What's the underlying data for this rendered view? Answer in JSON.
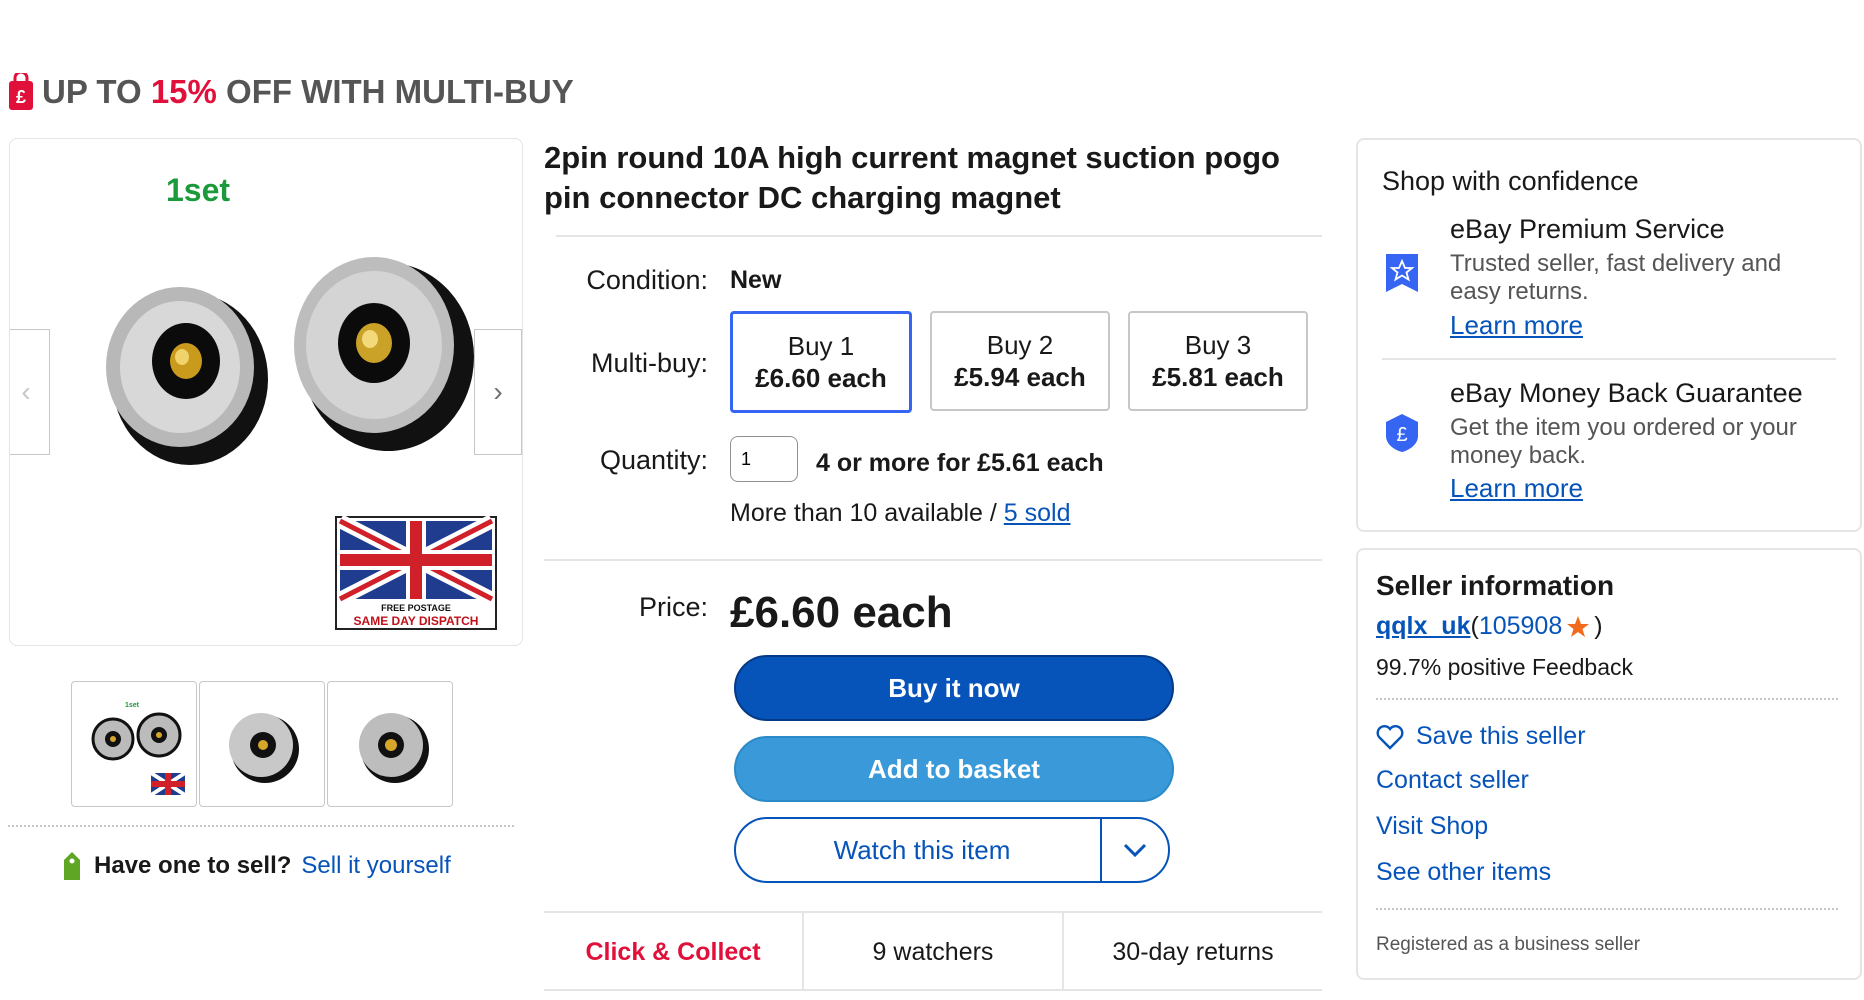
{
  "promo": {
    "prefix": "UP TO ",
    "highlight": "15%",
    "suffix": " OFF WITH MULTI-BUY"
  },
  "gallery": {
    "image_label": "1set",
    "flag_caption_top": "FREE POSTAGE",
    "flag_caption_bottom": "SAME DAY DISPATCH",
    "thumb1_label": "1set"
  },
  "sell": {
    "question": "Have one to sell?",
    "link": "Sell it yourself"
  },
  "item": {
    "title": "2pin round 10A high current magnet suction pogo pin connector DC charging magnet",
    "condition_label": "Condition:",
    "condition_value": "New",
    "multibuy_label": "Multi-buy:",
    "multibuy": [
      {
        "label": "Buy 1",
        "price": "£6.60 each",
        "selected": true
      },
      {
        "label": "Buy 2",
        "price": "£5.94 each",
        "selected": false
      },
      {
        "label": "Buy 3",
        "price": "£5.81 each",
        "selected": false
      }
    ],
    "quantity_label": "Quantity:",
    "quantity_value": "1",
    "quantity_offer": "4 or more for £5.61 each",
    "availability_text": "More than 10 available / ",
    "sold_link": "5 sold",
    "price_label": "Price:",
    "price_value": "£6.60 each",
    "buy_now": "Buy it now",
    "add_basket": "Add to basket",
    "watch": "Watch this item",
    "info": [
      "Click & Collect",
      "9 watchers",
      "30-day returns"
    ]
  },
  "confidence": {
    "title": "Shop with confidence",
    "items": [
      {
        "heading": "eBay Premium Service",
        "sub": "Trusted seller, fast delivery and easy returns.",
        "link": "Learn more",
        "icon": "premium-badge-icon"
      },
      {
        "heading": "eBay Money Back Guarantee",
        "sub": "Get the item you ordered or your money back.",
        "link": "Learn more",
        "icon": "pound-shield-icon"
      }
    ]
  },
  "seller": {
    "title": "Seller information",
    "name": "qqlx_uk",
    "score_open": "(",
    "score": "105908",
    "score_close": ")",
    "feedback": "99.7% positive Feedback",
    "save": "Save this seller",
    "contact": "Contact seller",
    "visit": "Visit Shop",
    "other": "See other items",
    "registered": "Registered as a business seller"
  },
  "colors": {
    "brand_blue": "#0654ba",
    "basket_blue": "#3a9ad9",
    "promo_red": "#e0103a",
    "collect_red": "#e0103a",
    "star_orange": "#f26a1b"
  }
}
